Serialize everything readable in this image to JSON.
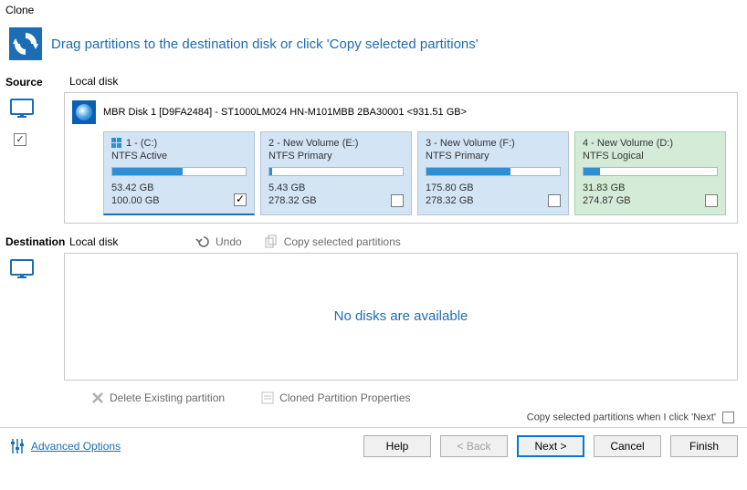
{
  "window": {
    "title": "Clone"
  },
  "header": {
    "text": "Drag partitions to the destination disk or click 'Copy selected partitions'"
  },
  "source": {
    "label": "Source",
    "sub": "Local disk",
    "disk_title": "MBR Disk 1 [D9FA2484] - ST1000LM024 HN-M101MBB 2BA30001  <931.51 GB>",
    "partitions": [
      {
        "name": "1 -  (C:)",
        "type": "NTFS Active",
        "used": "53.42 GB",
        "total": "100.00 GB",
        "fill": 53,
        "checked": true,
        "variant": "blue first",
        "win": true
      },
      {
        "name": "2 - New Volume (E:)",
        "type": "NTFS Primary",
        "used": "5.43 GB",
        "total": "278.32 GB",
        "fill": 2,
        "checked": false,
        "variant": "blue"
      },
      {
        "name": "3 - New Volume (F:)",
        "type": "NTFS Primary",
        "used": "175.80 GB",
        "total": "278.32 GB",
        "fill": 63,
        "checked": false,
        "variant": "blue"
      },
      {
        "name": "4 - New Volume (D:)",
        "type": "NTFS Logical",
        "used": "31.83 GB",
        "total": "274.87 GB",
        "fill": 12,
        "checked": false,
        "variant": "green"
      }
    ]
  },
  "destination": {
    "label": "Destination",
    "sub": "Local disk",
    "undo": "Undo",
    "copy": "Copy selected partitions",
    "empty": "No disks are available",
    "delete": "Delete Existing partition",
    "props": "Cloned Partition Properties"
  },
  "note": {
    "text": "Copy selected partitions when I click 'Next'"
  },
  "footer": {
    "adv": "Advanced Options",
    "help": "Help",
    "back": "< Back",
    "next": "Next >",
    "cancel": "Cancel",
    "finish": "Finish"
  }
}
